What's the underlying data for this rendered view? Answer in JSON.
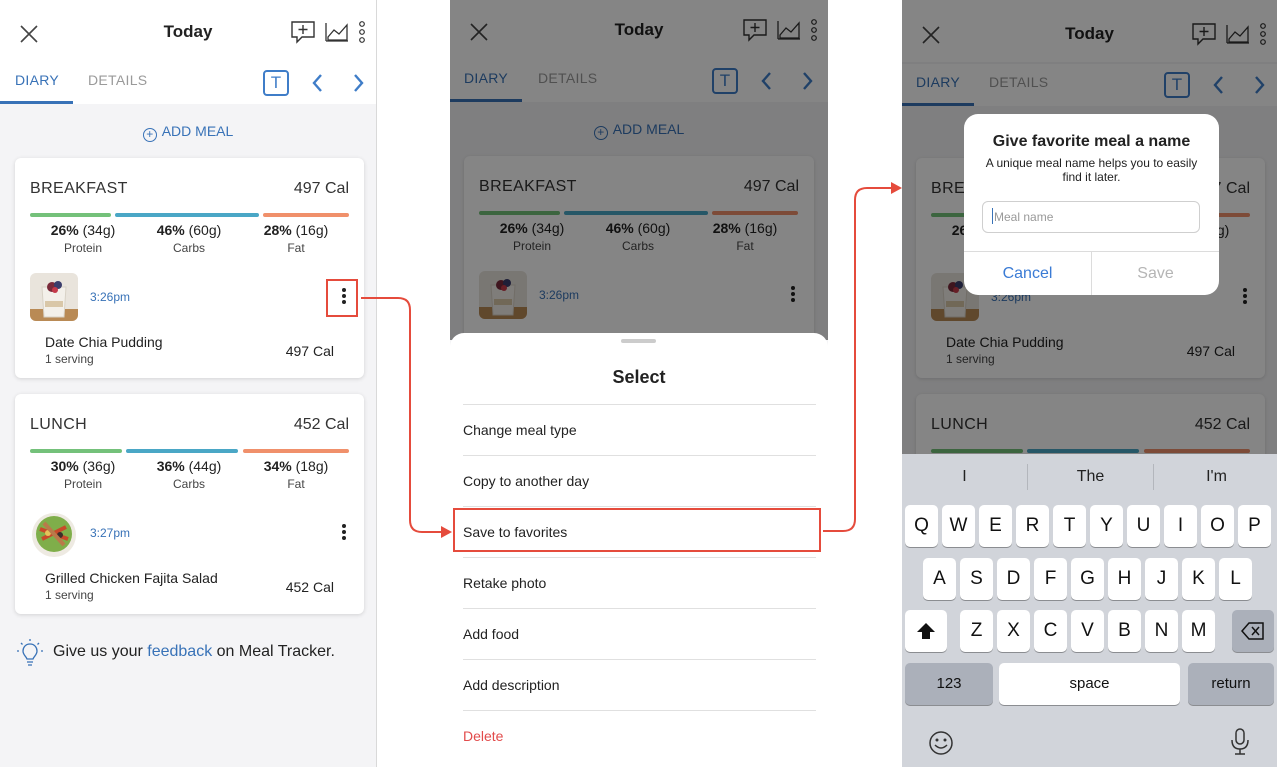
{
  "colors": {
    "accent": "#3872b7",
    "protein": "#74c17a",
    "carbs": "#4aa7c6",
    "fat": "#f0906b",
    "highlight": "#e54b3c",
    "danger": "#e24b4b"
  },
  "header": {
    "title": "Today",
    "close_icon": "close-icon",
    "icons": [
      "add-comment-icon",
      "chart-icon",
      "more-vertical-icon"
    ]
  },
  "tabs": {
    "diary": "DIARY",
    "details": "DETAILS",
    "t_toggle": "T"
  },
  "add_meal": {
    "label": "ADD MEAL",
    "icon": "plus-circle-icon"
  },
  "meals": [
    {
      "title": "BREAKFAST",
      "calories": "497 Cal",
      "macros": [
        {
          "pct": "26%",
          "grams": "(34g)",
          "name": "Protein"
        },
        {
          "pct": "46%",
          "grams": "(60g)",
          "name": "Carbs"
        },
        {
          "pct": "28%",
          "grams": "(16g)",
          "name": "Fat"
        }
      ],
      "time": "3:26pm",
      "food": {
        "name": "Date Chia Pudding",
        "serving": "1 serving",
        "calories": "497 Cal"
      }
    },
    {
      "title": "LUNCH",
      "calories": "452 Cal",
      "macros": [
        {
          "pct": "30%",
          "grams": "(36g)",
          "name": "Protein"
        },
        {
          "pct": "36%",
          "grams": "(44g)",
          "name": "Carbs"
        },
        {
          "pct": "34%",
          "grams": "(18g)",
          "name": "Fat"
        }
      ],
      "time": "3:27pm",
      "food": {
        "name": "Grilled Chicken Fajita Salad",
        "serving": "1 serving",
        "calories": "452 Cal"
      }
    }
  ],
  "feedback": {
    "prefix": "Give us your",
    "link": "feedback",
    "suffix": "on Meal Tracker."
  },
  "sheet": {
    "title": "Select",
    "items": [
      "Change meal type",
      "Copy to another day",
      "Save to favorites",
      "Retake photo",
      "Add food",
      "Add description",
      "Delete"
    ]
  },
  "dialog": {
    "title": "Give favorite meal a name",
    "message": "A unique meal name helps you to easily find it later.",
    "placeholder": "Meal name",
    "cancel": "Cancel",
    "save": "Save"
  },
  "keyboard": {
    "suggestions": [
      "I",
      "The",
      "I'm"
    ],
    "row1": [
      "Q",
      "W",
      "E",
      "R",
      "T",
      "Y",
      "U",
      "I",
      "O",
      "P"
    ],
    "row2": [
      "A",
      "S",
      "D",
      "F",
      "G",
      "H",
      "J",
      "K",
      "L"
    ],
    "row3": [
      "Z",
      "X",
      "C",
      "V",
      "B",
      "N",
      "M"
    ],
    "numbers": "123",
    "space": "space",
    "return": "return"
  }
}
